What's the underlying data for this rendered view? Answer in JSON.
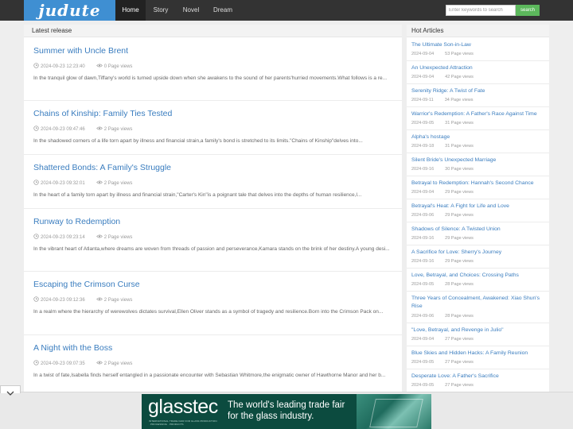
{
  "header": {
    "logo": "judute",
    "nav": [
      "Home",
      "Story",
      "Novel",
      "Dream"
    ],
    "active_nav": "Home",
    "search_placeholder": "Enter keywords to search",
    "search_button": "search"
  },
  "main": {
    "heading": "Latest release",
    "articles": [
      {
        "title": "Summer with Uncle Brent",
        "date": "2024-09-23 12:23:40",
        "views": "0 Page views",
        "desc": "In the tranquil glow of dawn,Tiffany's world is turned upside down when she awakens to the sound of her parents'hurried movements.What follows is a re..."
      },
      {
        "title": "Chains of Kinship: Family Ties Tested",
        "date": "2024-09-23 09:47:46",
        "views": "2 Page views",
        "desc": "In the shadowed corners of a life torn apart by illness and financial strain,a family's bond is stretched to its limits.\"Chains of Kinship\"delves into..."
      },
      {
        "title": "Shattered Bonds: A Family's Struggle",
        "date": "2024-09-23 09:32:01",
        "views": "2 Page views",
        "desc": "In the heart of a family torn apart by illness and financial strain,\"Carter's Kin\"is a poignant tale that delves into the depths of human resilience,l..."
      },
      {
        "title": "Runway to Redemption",
        "date": "2024-09-23 09:23:14",
        "views": "2 Page views",
        "desc": "In the vibrant heart of Atlanta,where dreams are woven from threads of passion and perseverance,Kamara stands on the brink of her destiny.A young desi..."
      },
      {
        "title": "Escaping the Crimson Curse",
        "date": "2024-09-23 09:12:36",
        "views": "2 Page views",
        "desc": "In a realm where the hierarchy of werewolves dictates survival,Ellen Oliver stands as a symbol of tragedy and resilience.Born into the Crimson Pack on..."
      },
      {
        "title": "A Night with the Boss",
        "date": "2024-09-23 09:07:35",
        "views": "2 Page views",
        "desc": "In a twist of fate,Isabella finds herself entangled in a passionate encounter with Sebastian Whitmore,the enigmatic owner of Hawthorne Manor and her b..."
      }
    ]
  },
  "sidebar": {
    "heading": "Hot Articles",
    "items": [
      {
        "title": "The Ultimate Son-in-Law",
        "date": "2024-09-04",
        "views": "53 Page views"
      },
      {
        "title": "An Unexpected Attraction",
        "date": "2024-09-04",
        "views": "42 Page views"
      },
      {
        "title": "Serenity Ridge: A Twist of Fate",
        "date": "2024-09-11",
        "views": "34 Page views"
      },
      {
        "title": "Warrior's Redemption: A Father's Race Against Time",
        "date": "2024-09-05",
        "views": "31 Page views"
      },
      {
        "title": "Alpha's hostage",
        "date": "2024-09-18",
        "views": "31 Page views"
      },
      {
        "title": "Silent Bride's Unexpected Marriage",
        "date": "2024-09-16",
        "views": "30 Page views"
      },
      {
        "title": "Betrayal to Redemption: Hannah's Second Chance",
        "date": "2024-09-04",
        "views": "29 Page views"
      },
      {
        "title": "Betrayal's Heat: A Fight for Life and Love",
        "date": "2024-09-06",
        "views": "29 Page views"
      },
      {
        "title": "Shadows of Silence: A Twisted Union",
        "date": "2024-09-16",
        "views": "29 Page views"
      },
      {
        "title": "A Sacrifice for Love: Sherry's Journey",
        "date": "2024-09-16",
        "views": "29 Page views"
      },
      {
        "title": "Love, Betrayal, and Choices: Crossing Paths",
        "date": "2024-09-05",
        "views": "28 Page views"
      },
      {
        "title": "Three Years of Concealment, Awakened: Xiao Shun's Rise",
        "date": "2024-09-06",
        "views": "28 Page views"
      },
      {
        "title": "\"Love, Betrayal, and Revenge in Julio\"",
        "date": "2024-09-04",
        "views": "27 Page views"
      },
      {
        "title": "Blue Skies and Hidden Hacks: A Family Reunion",
        "date": "2024-09-05",
        "views": "27 Page views"
      },
      {
        "title": "Desperate Love: A Father's Sacrifice",
        "date": "2024-09-05",
        "views": "27 Page views"
      }
    ]
  },
  "ad": {
    "brand": "glasstec",
    "tagline": "INTERNATIONAL TRADE FAIR FOR GLASS PRODUCTION · PROCESSING · PRODUCTS",
    "headline": "The world's leading trade fair for the glass industry.",
    "collapse_icon": "chevron-down-icon"
  },
  "colors": {
    "brand": "#3f8fd2",
    "navbar": "#333333",
    "link": "#3a7dbf",
    "search_button": "#5cb85c",
    "ad_bg": "#0c4b3f"
  }
}
